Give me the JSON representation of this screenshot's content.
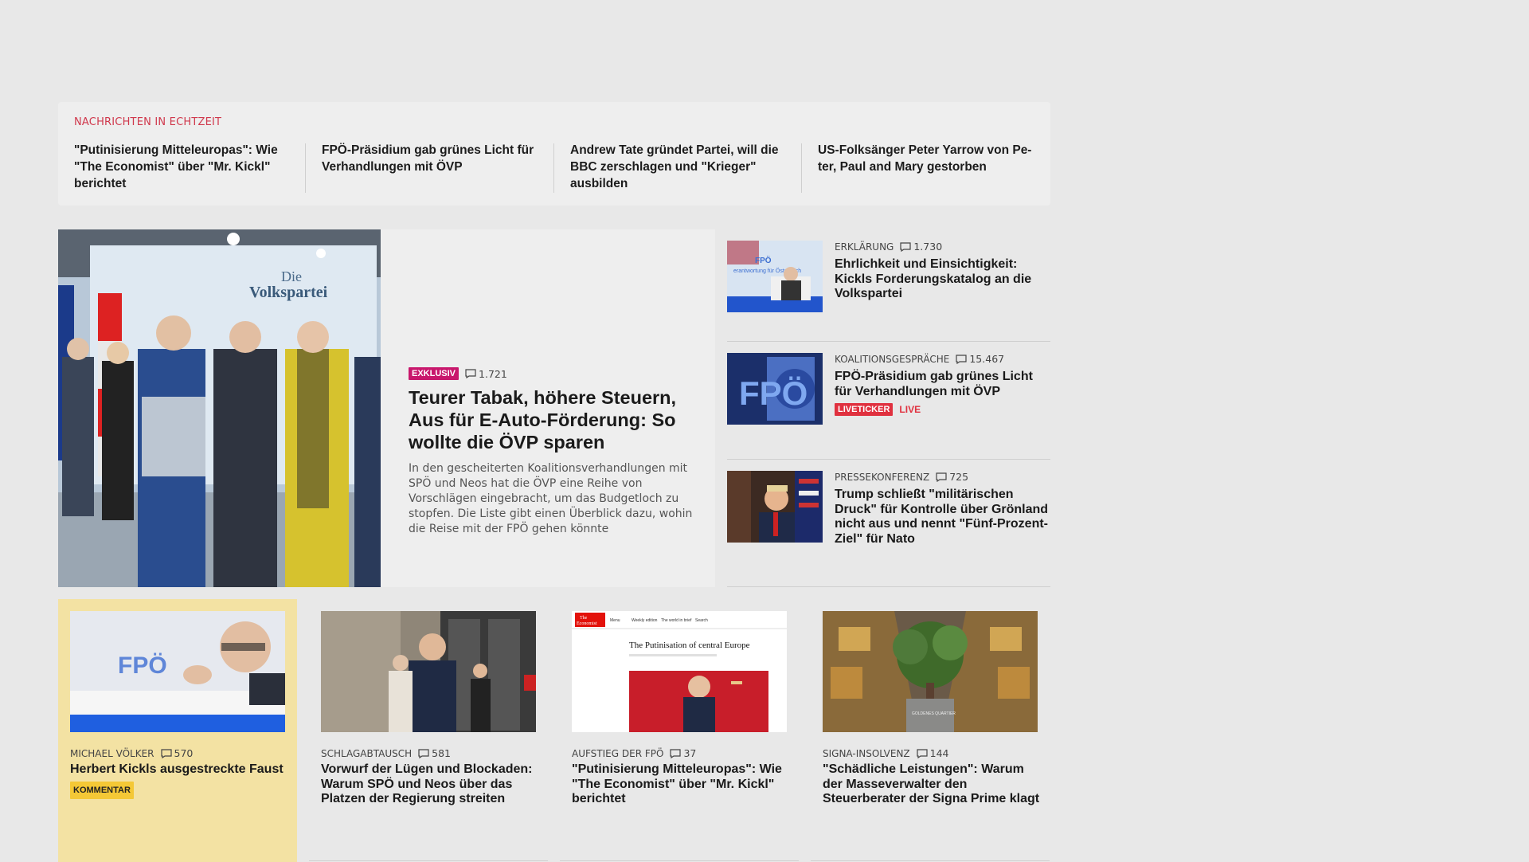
{
  "ticker": {
    "title": "NACHRICHTEN IN ECHTZEIT",
    "items": [
      "\"Putinisierung Mitteleuropas\": Wie \"The Economist\" über \"Mr. Kickl\" berichtet",
      "FPÖ-Präsidium gab grünes Licht für Verhandlungen mit ÖVP",
      "Andrew Tate gründet Partei, will die BBC zerschlagen und \"Krieger\" ausbilden",
      "US-Folksänger Peter Yarrow von Pe-ter, Paul and Mary gestorben"
    ]
  },
  "hero": {
    "tag": "EXKLUSIV",
    "comments": "1.721",
    "title": "Teurer Tabak, höhere Steuern, Aus für E-Auto-Förderung: So wollte die ÖVP sparen",
    "lead": "In den gescheiterten Koalitionsverhandlungen mit SPÖ und Neos hat die ÖVP eine Reihe von Vorschlägen eingebracht, um das Budgetloch zu stopfen. Die Liste gibt einen Überblick dazu, wohin die Reise mit der FPÖ gehen könnte",
    "image_text_line1": "Die",
    "image_text_line2": "Volkspartei"
  },
  "side": [
    {
      "kicker": "ERKLÄRUNG",
      "comments": "1.730",
      "title": "Ehrlichkeit und Einsichtigkeit: Kickls Forderungskatalog an die Volkspartei",
      "image_text": "FPÖ",
      "image_text2": "erantwortung für Österreich"
    },
    {
      "kicker": "KOALITIONSGESPRÄCHE",
      "comments": "15.467",
      "title": "FPÖ-Präsidium gab grünes Licht für Verhandlungen mit ÖVP",
      "badge": "LIVETICKER",
      "live": "LIVE",
      "image_text": "FPÖ"
    },
    {
      "kicker": "PRESSEKONFERENZ",
      "comments": "725",
      "title": "Trump schließt \"militärischen Druck\" für Kontrolle über Grönland nicht aus und nennt \"Fünf-Prozent-Ziel\" für Nato"
    }
  ],
  "cards": [
    {
      "kicker": "MICHAEL VÖLKER",
      "comments": "570",
      "title": "Herbert Kickls ausgestreckte Faust",
      "badge": "KOMMENTAR",
      "image_text": "FPÖ"
    },
    {
      "kicker": "SCHLAGABTAUSCH",
      "comments": "581",
      "title": "Vorwurf der Lügen und Blockaden: Warum SPÖ und Neos über das Platzen der Regierung streiten"
    },
    {
      "kicker": "AUFSTIEG DER FPÖ",
      "comments": "37",
      "title": "\"Putinisierung Mitteleuropas\": Wie \"The Economist\" über \"Mr. Kickl\" berichtet",
      "image_heading": "The Putinisation of central Europe",
      "image_logo_line1": "The",
      "image_logo_line2": "Economist",
      "image_nav": [
        "Menu",
        "Weekly edition",
        "The world in brief",
        "Search"
      ]
    },
    {
      "kicker": "SIGNA-INSOLVENZ",
      "comments": "144",
      "title": "\"Schädliche Leistungen\": Warum der Masseverwalter den Steuerberater der Signa Prime klagt",
      "image_text": "GOLDENES QUARTIER"
    }
  ]
}
